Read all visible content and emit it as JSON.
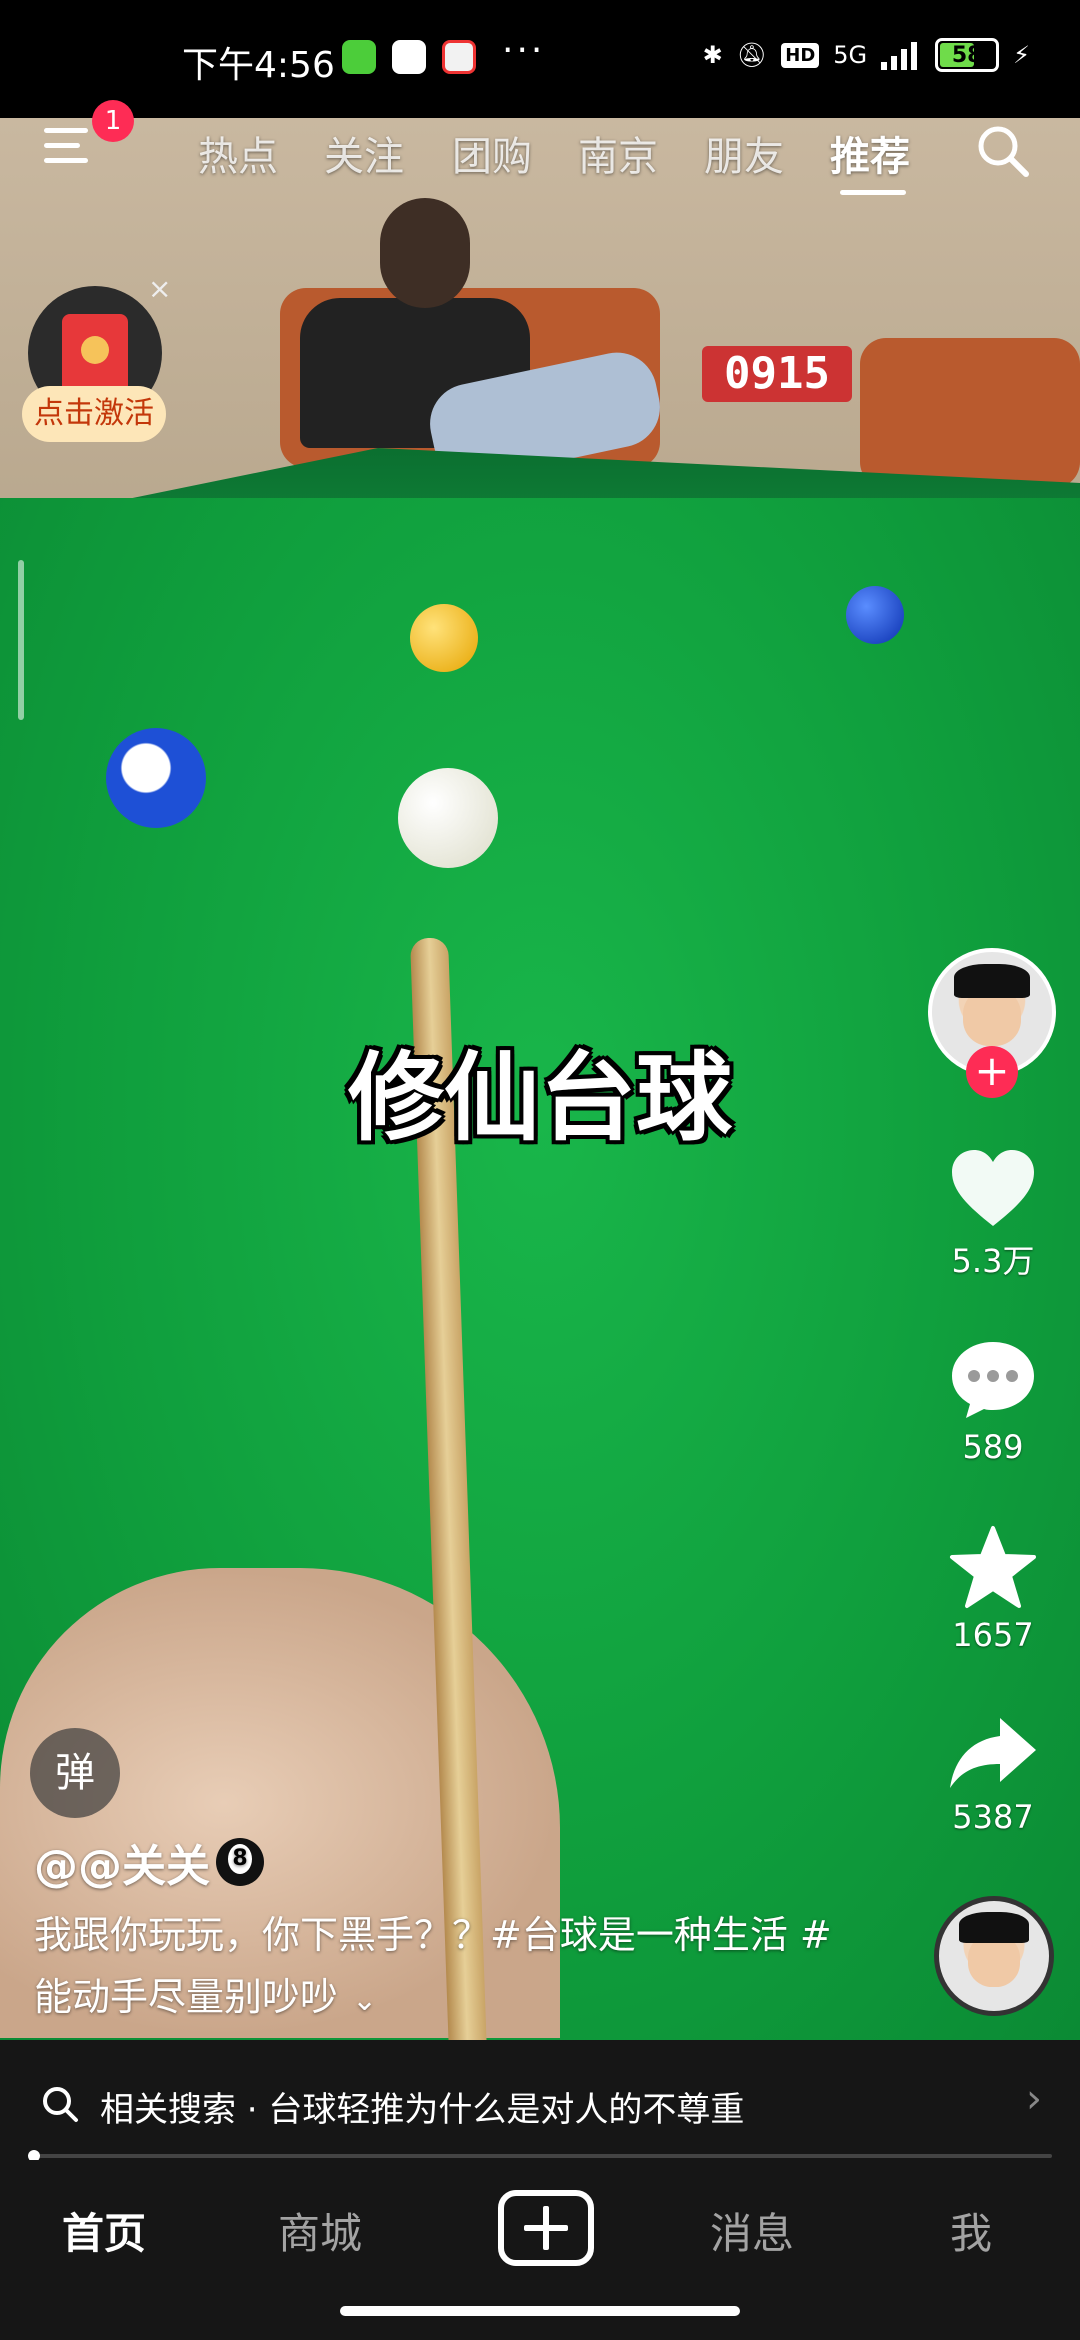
{
  "status_bar": {
    "time": "下午4:56",
    "more": "···",
    "network": "5G",
    "hd": "HD",
    "battery": "58"
  },
  "top_nav": {
    "badge_count": "1",
    "tabs": [
      "热点",
      "关注",
      "团购",
      "南京",
      "朋友",
      "推荐"
    ],
    "active_tab": "推荐"
  },
  "red_packet": {
    "label": "点击激活",
    "close": "×"
  },
  "video": {
    "overlay_title": "修仙台球",
    "scoreboard": "0915"
  },
  "actions": {
    "likes": "5.3万",
    "comments": "589",
    "favorites": "1657",
    "shares": "5387"
  },
  "post": {
    "danmu_button": "弹",
    "author": "@@关关",
    "description": "我跟你玩玩，你下黑手？？#台球是一种生活 #能动手尽量别吵吵"
  },
  "related_search": {
    "text": "相关搜索 · 台球轻推为什么是对人的不尊重"
  },
  "bottom_nav": {
    "items": [
      "首页",
      "商城",
      "消息",
      "我"
    ]
  },
  "colors": {
    "accent": "#fe2c55",
    "felt": "#14a845"
  }
}
